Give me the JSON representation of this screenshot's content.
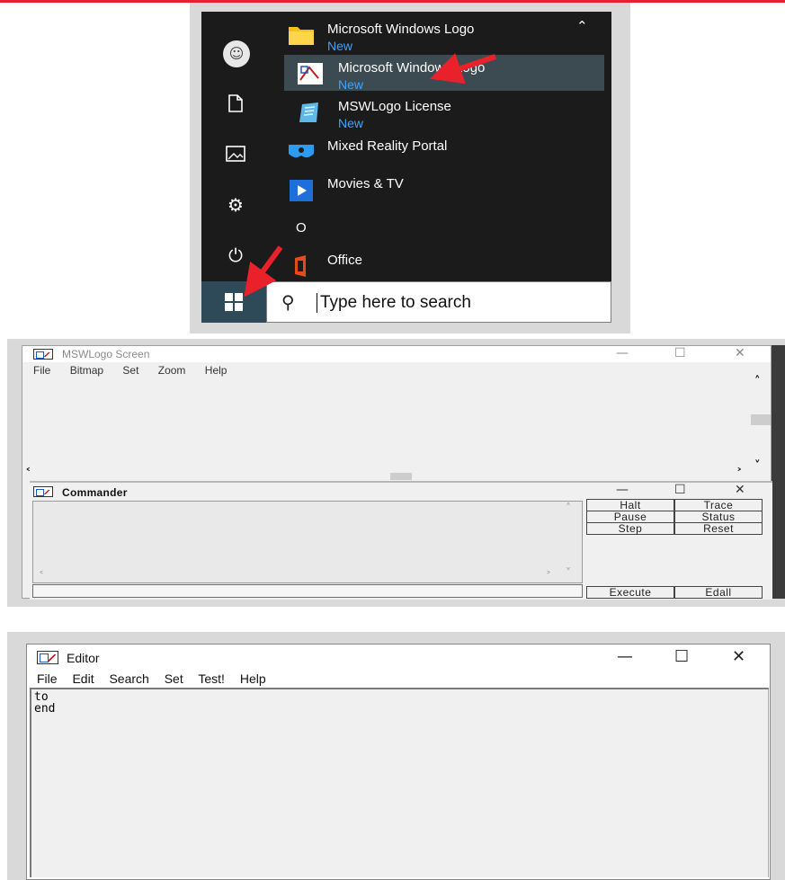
{
  "start_menu": {
    "rail_icons": [
      "user-avatar-icon",
      "document-icon",
      "pictures-icon",
      "settings-gear-icon",
      "power-icon"
    ],
    "apps": [
      {
        "name": "Microsoft Windows Logo",
        "sub": "New",
        "icon": "folder-icon"
      },
      {
        "name": "Microsoft Windows Logo",
        "sub": "New",
        "icon": "mswlogo-app-icon"
      },
      {
        "name": "MSWLogo License",
        "sub": "New",
        "icon": "license-doc-icon"
      },
      {
        "name": "Mixed Reality Portal",
        "icon": "mixed-reality-icon"
      },
      {
        "name": "Movies & TV",
        "icon": "movies-tv-icon"
      },
      {
        "name": "Office",
        "icon": "office-icon"
      }
    ],
    "section_letter": "O",
    "search_placeholder": "Type here to search",
    "accent_color": "#3fa3ff",
    "annotation_color": "#e8212b"
  },
  "mswlogo_screen": {
    "title": "MSWLogo Screen",
    "menu": [
      "File",
      "Bitmap",
      "Set",
      "Zoom",
      "Help"
    ]
  },
  "commander": {
    "title": "Commander",
    "buttons": {
      "halt": "Halt",
      "trace": "Trace",
      "pause": "Pause",
      "status": "Status",
      "step": "Step",
      "reset": "Reset",
      "execute": "Execute",
      "edall": "Edall"
    }
  },
  "editor": {
    "title": "Editor",
    "menu": [
      "File",
      "Edit",
      "Search",
      "Set",
      "Test!",
      "Help"
    ],
    "lines": [
      "to",
      "end"
    ]
  }
}
